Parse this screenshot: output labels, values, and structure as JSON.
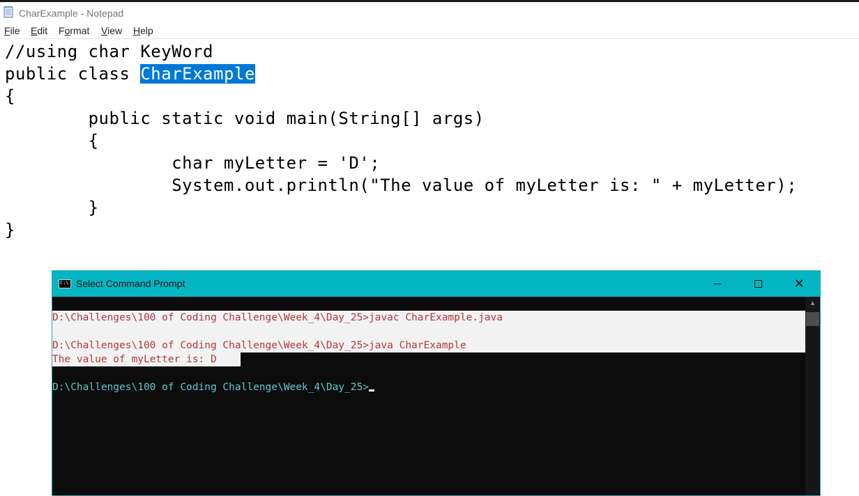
{
  "notepad": {
    "title": "CharExample - Notepad",
    "menu": [
      {
        "accel": "F",
        "rest": "ile"
      },
      {
        "accel": "E",
        "rest": "dit"
      },
      {
        "accel": "",
        "pre": "F",
        "accel2": "o",
        "rest": "rmat"
      },
      {
        "accel": "V",
        "rest": "iew"
      },
      {
        "accel": "H",
        "rest": "elp"
      }
    ],
    "menu_labels": [
      "File",
      "Edit",
      "Format",
      "View",
      "Help"
    ],
    "code": {
      "line1": "//using char KeyWord",
      "line2_pre": "public class ",
      "line2_sel": "CharExample",
      "line3": "{",
      "line4": "        public static void main(String[] args)",
      "line5": "        {",
      "line6": "                char myLetter = 'D';",
      "line7": "                System.out.println(\"The value of myLetter is: \" + myLetter);",
      "line8": "        }",
      "line9": "}"
    }
  },
  "cmd": {
    "title": "Select Command Prompt",
    "icon_text": "C:\\",
    "lines": {
      "l1": "D:\\Challenges\\100 of Coding Challenge\\Week_4\\Day_25>javac CharExample.java",
      "l2": "D:\\Challenges\\100 of Coding Challenge\\Week_4\\Day_25>java CharExample",
      "l3": "The value of myLetter is: D  ",
      "l4": "D:\\Challenges\\100 of Coding Challenge\\Week_4\\Day_25>"
    }
  },
  "colors": {
    "selection": "#0078d7",
    "cmd_titlebar": "#04b6c3",
    "console_bg": "#0c0c0c",
    "console_red": "#b03a3a",
    "console_cyan": "#5ec8d2"
  }
}
